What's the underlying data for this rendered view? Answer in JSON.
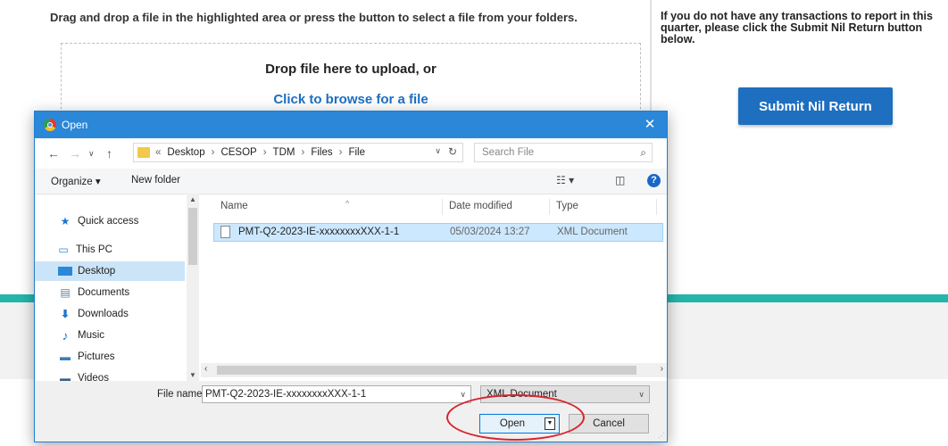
{
  "page": {
    "instruction": "Drag and drop a file in the highlighted area or press the button to select a file from your folders.",
    "drop_title": "Drop file here to upload, or",
    "browse_link": "Click to browse for a file",
    "nil_text": "If you do not have any transactions to report in this quarter, please click the Submit Nil Return button below.",
    "nil_button": "Submit Nil Return",
    "accent_color": "#1e6fc0",
    "band_color": "#25b5ac"
  },
  "dialog": {
    "title": "Open",
    "close": "✕",
    "address": {
      "prefix": "«",
      "crumbs": [
        "Desktop",
        "CESOP",
        "TDM",
        "Files",
        "File"
      ]
    },
    "search_placeholder": "Search File",
    "toolbar": {
      "organize": "Organize ▾",
      "new_folder": "New folder",
      "help": "?"
    },
    "nav": {
      "quick_access": "Quick access",
      "this_pc": "This PC",
      "items": [
        "Desktop",
        "Documents",
        "Downloads",
        "Music",
        "Pictures",
        "Videos"
      ],
      "selected": "Desktop"
    },
    "columns": {
      "name": "Name",
      "date_modified": "Date modified",
      "type": "Type"
    },
    "files": [
      {
        "name": "PMT-Q2-2023-IE-xxxxxxxxXXX-1-1",
        "date_modified": "05/03/2024 13:27",
        "type": "XML Document"
      }
    ],
    "file_name_label": "File name:",
    "file_name_value": "PMT-Q2-2023-IE-xxxxxxxxXXX-1-1",
    "file_type": "XML Document",
    "open_button": "Open",
    "cancel_button": "Cancel"
  }
}
